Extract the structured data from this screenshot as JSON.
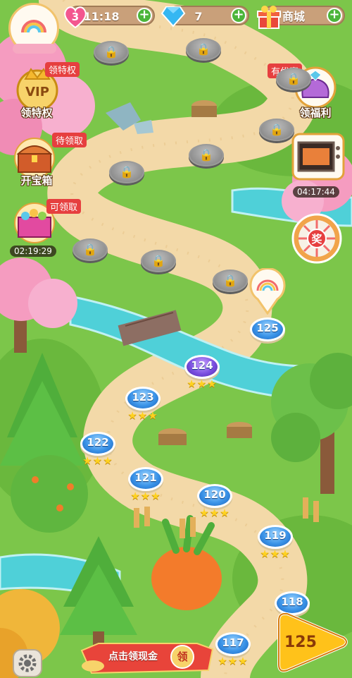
{
  "status_bar": {
    "lives": "3",
    "life_timer": "11:18",
    "gems": "7",
    "shop_label": "商城"
  },
  "left_buttons": {
    "vip_tag": "领特权",
    "vip_label": "领特权",
    "vip_badge": "VIP",
    "chest_tag": "待领取",
    "chest_label": "开宝箱",
    "gift_tag": "可领取",
    "gift_timer": "02:19:29"
  },
  "right_buttons": {
    "welfare_tag": "有优惠",
    "welfare_label": "领福利",
    "oven_timer": "04:17:44",
    "wheel_label": "奖"
  },
  "levels": [
    {
      "num": "125",
      "stars": 0,
      "current": true
    },
    {
      "num": "124",
      "stars": 3
    },
    {
      "num": "123",
      "stars": 3
    },
    {
      "num": "122",
      "stars": 3
    },
    {
      "num": "121",
      "stars": 3
    },
    {
      "num": "120",
      "stars": 3
    },
    {
      "num": "119",
      "stars": 3
    },
    {
      "num": "118",
      "stars": 0
    },
    {
      "num": "117",
      "stars": 3
    }
  ],
  "bottom": {
    "cash_banner": "点击领现金",
    "cash_badge": "领",
    "play_level": "125"
  },
  "colors": {
    "grass": "#7cc64a",
    "path": "#f3d9a8",
    "river": "#4fd0d8",
    "level_blue": "#3a93e8",
    "tag_red": "#e63f3f",
    "play_yellow": "#ffc21a"
  }
}
